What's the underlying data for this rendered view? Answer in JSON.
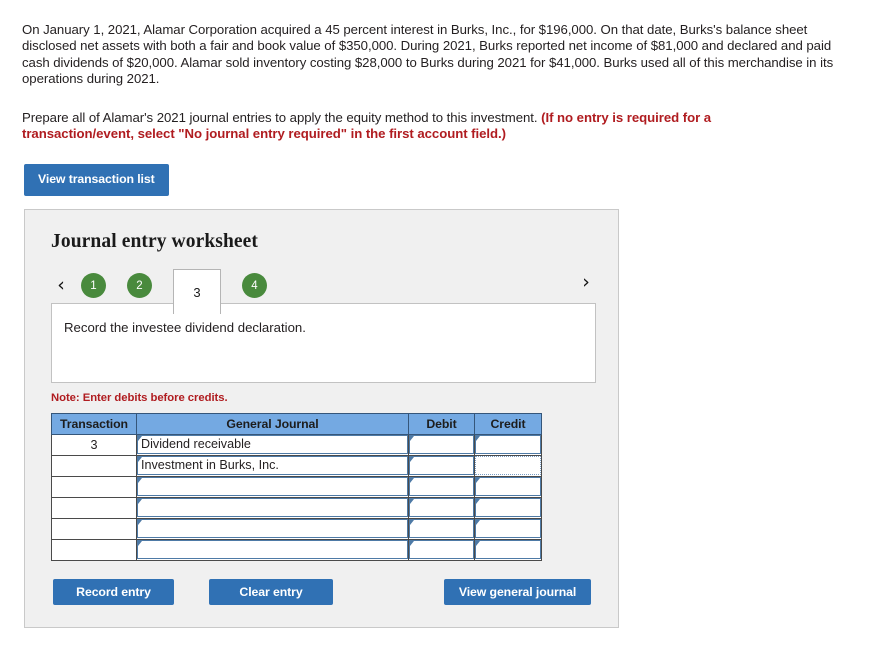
{
  "problem": {
    "paragraph": "On January 1, 2021, Alamar Corporation acquired a 45 percent interest in Burks, Inc., for $196,000. On that date, Burks's balance sheet disclosed net assets with both a fair and book value of $350,000. During 2021, Burks reported net income of $81,000 and declared and paid cash dividends of $20,000. Alamar sold inventory costing $28,000 to Burks during 2021 for $41,000. Burks used all of this merchandise in its operations during 2021.",
    "instruction_plain": "Prepare all of Alamar's 2021 journal entries to apply the equity method to this investment. ",
    "instruction_emphasis": "(If no entry is required for a transaction/event, select \"No journal entry required\" in the first account field.)"
  },
  "toolbar": {
    "view_transaction_list_label": "View transaction list"
  },
  "worksheet": {
    "title": "Journal entry worksheet",
    "nav": {
      "prev_icon": "chevron-left-icon",
      "next_icon": "chevron-right-icon",
      "prev_glyph": "‹",
      "next_glyph": "›"
    },
    "tabs": [
      {
        "label": "1",
        "active": false
      },
      {
        "label": "2",
        "active": false
      },
      {
        "label": "3",
        "active": true
      },
      {
        "label": "4",
        "active": false
      }
    ],
    "description": "Record the investee dividend declaration.",
    "note": "Note: Enter debits before credits.",
    "table": {
      "headers": [
        "Transaction",
        "General Journal",
        "Debit",
        "Credit"
      ],
      "rows": [
        {
          "transaction": "3",
          "account": "Dividend receivable",
          "debit": "",
          "credit": "",
          "credit_focus": false
        },
        {
          "transaction": "",
          "account": "Investment in Burks, Inc.",
          "debit": "",
          "credit": "",
          "credit_focus": true
        },
        {
          "transaction": "",
          "account": "",
          "debit": "",
          "credit": "",
          "credit_focus": false
        },
        {
          "transaction": "",
          "account": "",
          "debit": "",
          "credit": "",
          "credit_focus": false
        },
        {
          "transaction": "",
          "account": "",
          "debit": "",
          "credit": "",
          "credit_focus": false
        },
        {
          "transaction": "",
          "account": "",
          "debit": "",
          "credit": "",
          "credit_focus": false
        }
      ]
    },
    "buttons": {
      "record_entry": "Record entry",
      "clear_entry": "Clear entry",
      "view_general_journal": "View general journal"
    }
  },
  "colors": {
    "button_blue": "#3071b4",
    "tab_green": "#498a3d",
    "table_header_blue": "#74a9e2",
    "alert_red": "#b01c20",
    "panel_bg": "#f0f0f0"
  }
}
